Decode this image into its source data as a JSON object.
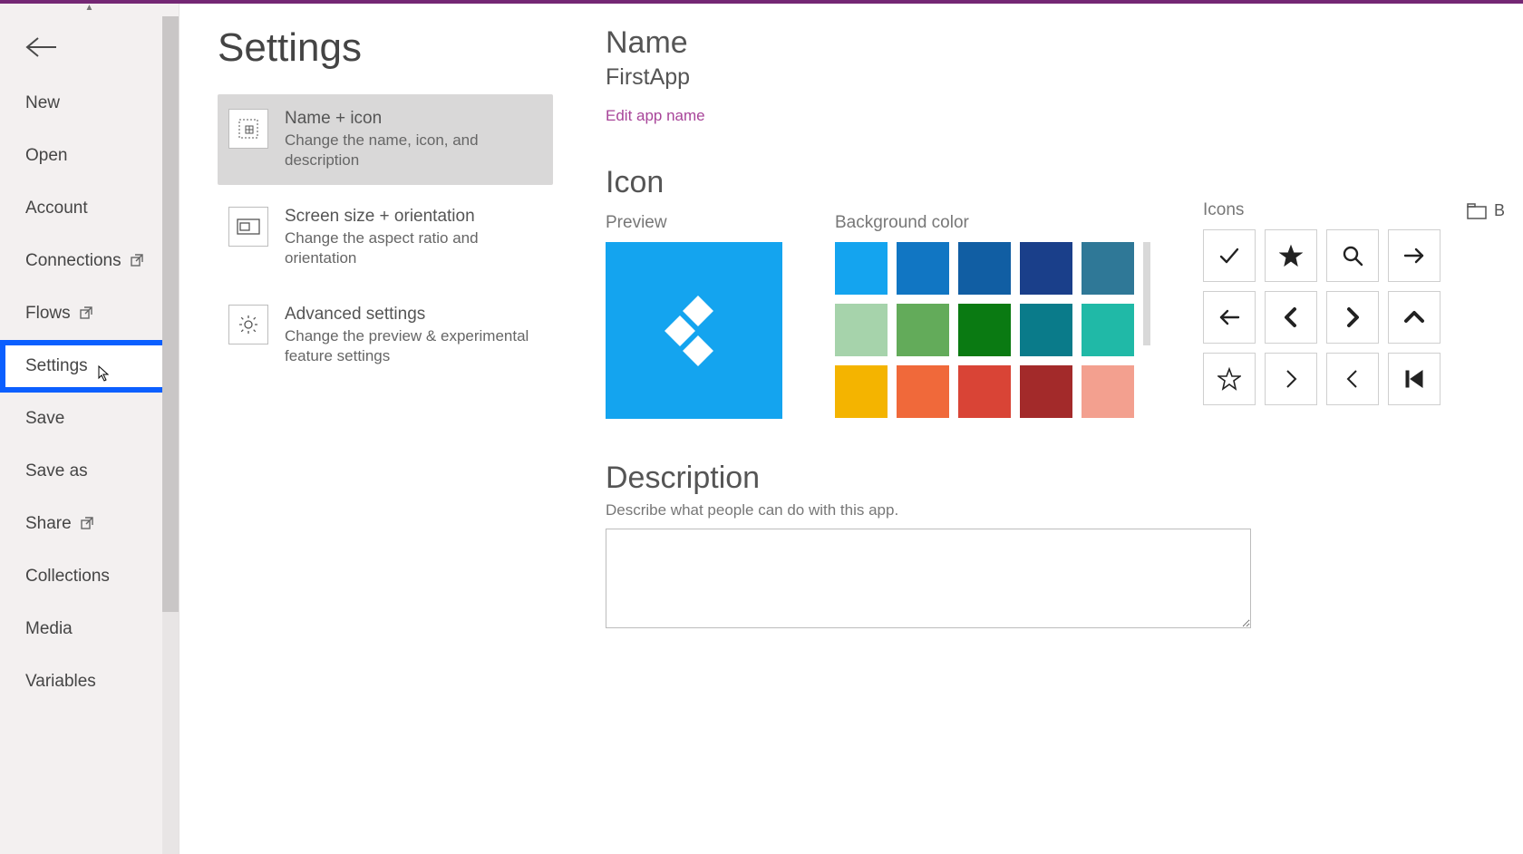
{
  "sidebar": {
    "items": [
      {
        "label": "New",
        "external": false
      },
      {
        "label": "Open",
        "external": false
      },
      {
        "label": "Account",
        "external": false
      },
      {
        "label": "Connections",
        "external": true
      },
      {
        "label": "Flows",
        "external": true
      },
      {
        "label": "Settings",
        "external": false,
        "highlighted": true
      },
      {
        "label": "Save",
        "external": false
      },
      {
        "label": "Save as",
        "external": false
      },
      {
        "label": "Share",
        "external": true
      },
      {
        "label": "Collections",
        "external": false
      },
      {
        "label": "Media",
        "external": false
      },
      {
        "label": "Variables",
        "external": false
      }
    ]
  },
  "page": {
    "title": "Settings"
  },
  "categories": [
    {
      "title": "Name + icon",
      "desc": "Change the name, icon, and description",
      "selected": true
    },
    {
      "title": "Screen size + orientation",
      "desc": "Change the aspect ratio and orientation",
      "selected": false
    },
    {
      "title": "Advanced settings",
      "desc": "Change the preview & experimental feature settings",
      "selected": false
    }
  ],
  "detail": {
    "name_heading": "Name",
    "app_name": "FirstApp",
    "edit_link": "Edit app name",
    "icon_heading": "Icon",
    "preview_label": "Preview",
    "bgcolor_label": "Background color",
    "icons_label": "Icons",
    "browse_label": "B",
    "desc_heading": "Description",
    "desc_hint": "Describe what people can do with this app.",
    "desc_value": ""
  },
  "colors": [
    "#14a4ef",
    "#1176c3",
    "#115ea3",
    "#1a3f8a",
    "#2f7897",
    "#a6d3ab",
    "#63ab5a",
    "#0a7a12",
    "#0a7b8a",
    "#20b9a7",
    "#f4b400",
    "#f0693a",
    "#d94436",
    "#a32a2a",
    "#f3a08f"
  ],
  "icons_palette": [
    "check",
    "star",
    "search",
    "arrow-right",
    "arrow-left",
    "chevron-left",
    "chevron-right",
    "chevron-up",
    "star-outline",
    "angle-right",
    "angle-left",
    "skip-back"
  ]
}
